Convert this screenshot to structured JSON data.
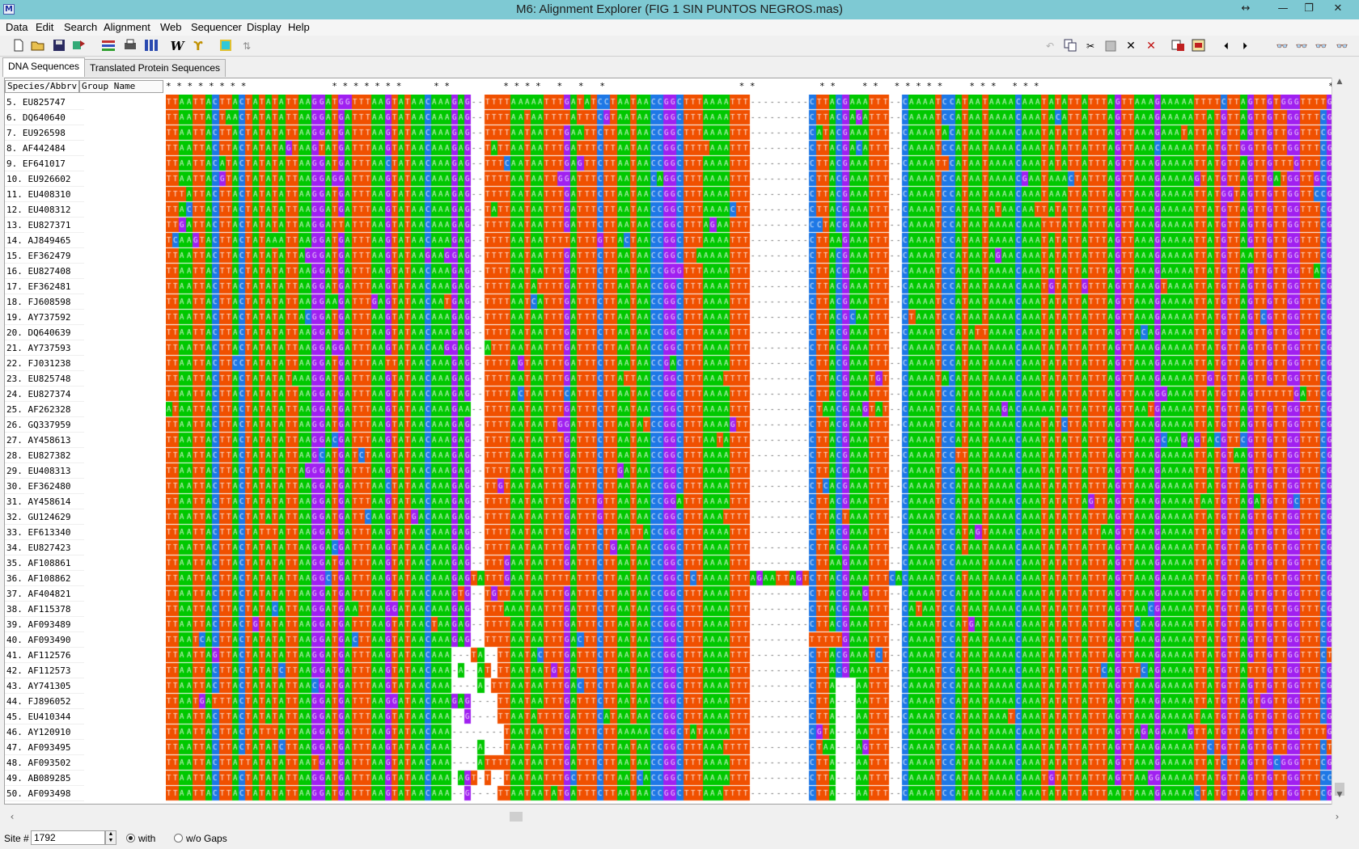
{
  "window": {
    "title": "M6: Alignment Explorer (FIG 1 SIN  PUNTOS NEGROS.mas)",
    "app_icon_glyph": "M",
    "controls": [
      "↔",
      "—",
      "❐",
      "✕"
    ]
  },
  "menu": [
    "Data",
    "Edit",
    "Search",
    "Alignment",
    "Web",
    "Sequencer",
    "Display",
    "Help"
  ],
  "toolbar": {
    "left_icons": [
      "new-file-icon",
      "open-folder-icon",
      "save-icon",
      "export-icon",
      "align-icon",
      "print-icon",
      "clustalw-icon",
      "muscle-w-icon",
      "muscle-icon",
      "highlight-icon",
      "translate-icon"
    ],
    "right_icons": [
      "undo-icon",
      "copy-icon",
      "cut-icon",
      "paste-icon",
      "delete-icon",
      "delete-gap-icon",
      "mark-icon",
      "edit-icon",
      "previous-icon",
      "next-icon",
      "find-icon",
      "find-previous-icon",
      "find-next-icon",
      "find-marked-icon"
    ]
  },
  "tabs": [
    {
      "label": "DNA Sequences",
      "active": true
    },
    {
      "label": "Translated Protein Sequences",
      "active": false
    }
  ],
  "grid": {
    "col_species": "Species/Abbrv",
    "col_group": "Group Name",
    "consensus": "* * * * * * * *                * * * * * * *      * *          * * * *   *   *   *                         * *            * *     * *   * * * * *     * * *   * * *                                                      * *   *     * * * *   * * * * * * * * * * * * * * * * * * * * * * * *   * * * * * * *         * * *",
    "rows": [
      "5. EU825747",
      "6. DQ640640",
      "7. EU926598",
      "8. AF442484",
      "9. EF641017",
      "10. EU926602",
      "11. EU408310",
      "12. EU408312",
      "13. EU827371",
      "14. AJ849465",
      "15. EF362479",
      "16. EU827408",
      "17. EF362481",
      "18. FJ608598",
      "19. AY737592",
      "20. DQ640639",
      "21. AY737593",
      "22. FJ031238",
      "23. EU825748",
      "24. EU827374",
      "25. AF262328",
      "26. GQ337959",
      "27. AY458613",
      "28. EU827382",
      "29. EU408313",
      "30. EF362480",
      "31. AY458614",
      "32. GU124629",
      "33. EF613340",
      "34. EU827423",
      "35. AF108861",
      "36. AF108862",
      "37. AF404821",
      "38. AF115378",
      "39. AF093489",
      "40. AF093490",
      "41. AF112576",
      "42. AF112573",
      "43. AY741305",
      "44. FJ896052",
      "45. EU410344",
      "46. AY120910",
      "47. AF093495",
      "48. AF093502",
      "49. AB089285",
      "50. AF093498"
    ],
    "colors": {
      "A": "#00c800",
      "T": "#f05000",
      "C": "#1e78e6",
      "G": "#a020f0",
      "gap": "#ffffff"
    }
  },
  "status": {
    "site_label": "Site #",
    "site_value": "1792",
    "with_label": "with",
    "wo_label": "w/o Gaps"
  }
}
